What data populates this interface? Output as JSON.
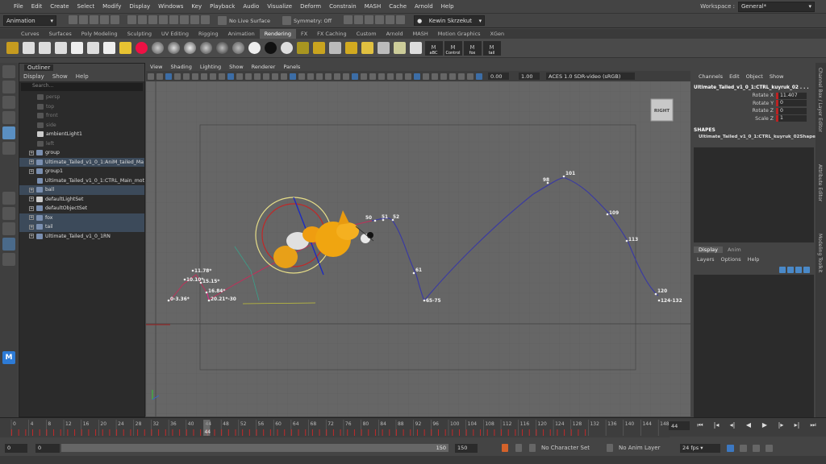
{
  "menubar": {
    "items": [
      "File",
      "Edit",
      "Create",
      "Select",
      "Modify",
      "Display",
      "Windows",
      "Key",
      "Playback",
      "Audio",
      "Visualize",
      "Deform",
      "Constrain",
      "MASH",
      "Cache",
      "Arnold",
      "Help"
    ],
    "workspace_label": "Workspace :",
    "workspace_value": "General*"
  },
  "statusline": {
    "menuset": "Animation",
    "live_surface": "No Live Surface",
    "symmetry": "Symmetry: Off",
    "user": "Kewin Skrzekut"
  },
  "shelf": {
    "tabs": [
      "Curves",
      "Surfaces",
      "Poly Modeling",
      "Sculpting",
      "UV Editing",
      "Rigging",
      "Animation",
      "Rendering",
      "FX",
      "FX Caching",
      "Custom",
      "Arnold",
      "MASH",
      "Motion Graphics",
      "XGen"
    ],
    "active_tab": "Rendering",
    "custom_buttons": [
      "aBC",
      "Control",
      "fox",
      "tail"
    ]
  },
  "outliner": {
    "title": "Outliner",
    "menu": [
      "Display",
      "Show",
      "Help"
    ],
    "search_placeholder": "Search...",
    "items": [
      {
        "label": "persp",
        "hidden": true,
        "indent": 1,
        "sel": false
      },
      {
        "label": "top",
        "hidden": true,
        "indent": 1,
        "sel": false
      },
      {
        "label": "front",
        "hidden": true,
        "indent": 1,
        "sel": false
      },
      {
        "label": "side",
        "hidden": true,
        "indent": 1,
        "sel": false
      },
      {
        "label": "ambientLight1",
        "hidden": false,
        "indent": 1,
        "sel": false
      },
      {
        "label": "left",
        "hidden": true,
        "indent": 1,
        "sel": false
      },
      {
        "label": "group",
        "hidden": false,
        "indent": 0,
        "sel": false
      },
      {
        "label": "Ultimate_Tailed_v1_0_1:AniM_tailed_Ma",
        "hidden": false,
        "indent": 0,
        "sel": true
      },
      {
        "label": "group1",
        "hidden": false,
        "indent": 0,
        "sel": false
      },
      {
        "label": "Ultimate_Tailed_v1_0_1:CTRL_Main_mot",
        "hidden": false,
        "indent": 1,
        "sel": false
      },
      {
        "label": "ball",
        "hidden": false,
        "indent": 0,
        "sel": true
      },
      {
        "label": "defaultLightSet",
        "hidden": false,
        "indent": 0,
        "sel": false
      },
      {
        "label": "defaultObjectSet",
        "hidden": false,
        "indent": 0,
        "sel": false
      },
      {
        "label": "fox",
        "hidden": false,
        "indent": 0,
        "sel": true
      },
      {
        "label": "tail",
        "hidden": false,
        "indent": 0,
        "sel": true
      },
      {
        "label": "Ultimate_Tailed_v1_0_1RN",
        "hidden": false,
        "indent": 0,
        "sel": false
      }
    ]
  },
  "viewport": {
    "menu": [
      "View",
      "Shading",
      "Lighting",
      "Show",
      "Renderer",
      "Panels"
    ],
    "exposure": "0.00",
    "gamma": "1.00",
    "color_space": "ACES 1.0 SDR-video (sRGB)",
    "view_cube": "RIGHT",
    "frame_labels": [
      "0-3.36*",
      "10.10*",
      "11.78*",
      "15.15*",
      "16.84*",
      "20.21*-30",
      "50",
      "51",
      "52",
      "61",
      "65-75",
      "98",
      "101",
      "109",
      "113",
      "120",
      "124-132"
    ]
  },
  "channelbox": {
    "tabs_label": "Channels",
    "menu": [
      "Channels",
      "Edit",
      "Object",
      "Show"
    ],
    "object_name": "Ultimate_Tailed_v1_0_1:CTRL_kuyruk_02 . . .",
    "attributes": [
      {
        "label": "Rotate X",
        "value": "11.407"
      },
      {
        "label": "Rotate Y",
        "value": "0"
      },
      {
        "label": "Rotate Z",
        "value": "0"
      },
      {
        "label": "Scale Z",
        "value": "1"
      }
    ],
    "shapes_header": "SHAPES",
    "shape_name": "Ultimate_Tailed_v1_0_1:CTRL_kuyruk_02Shape",
    "layer_tabs": [
      "Display",
      "Anim"
    ],
    "layer_menu": [
      "Layers",
      "Options",
      "Help"
    ]
  },
  "sidetabs": [
    "Channel Box / Layer Editor",
    "Attribute Editor",
    "Modeling Toolkit"
  ],
  "timeline": {
    "ticks": [
      "0",
      "4",
      "8",
      "12",
      "16",
      "20",
      "24",
      "28",
      "32",
      "36",
      "40",
      "44",
      "48",
      "52",
      "56",
      "60",
      "64",
      "68",
      "72",
      "76",
      "80",
      "84",
      "88",
      "92",
      "96",
      "100",
      "104",
      "108",
      "112",
      "116",
      "120",
      "124",
      "128",
      "132",
      "136",
      "140",
      "144",
      "148"
    ],
    "current_frame": "44",
    "current_frame_field": "44"
  },
  "range": {
    "start": "0",
    "playback_start": "0",
    "playback_end": "150",
    "end": "150",
    "character_set": "No Character Set",
    "anim_layer": "No Anim Layer",
    "fps": "24 fps"
  }
}
